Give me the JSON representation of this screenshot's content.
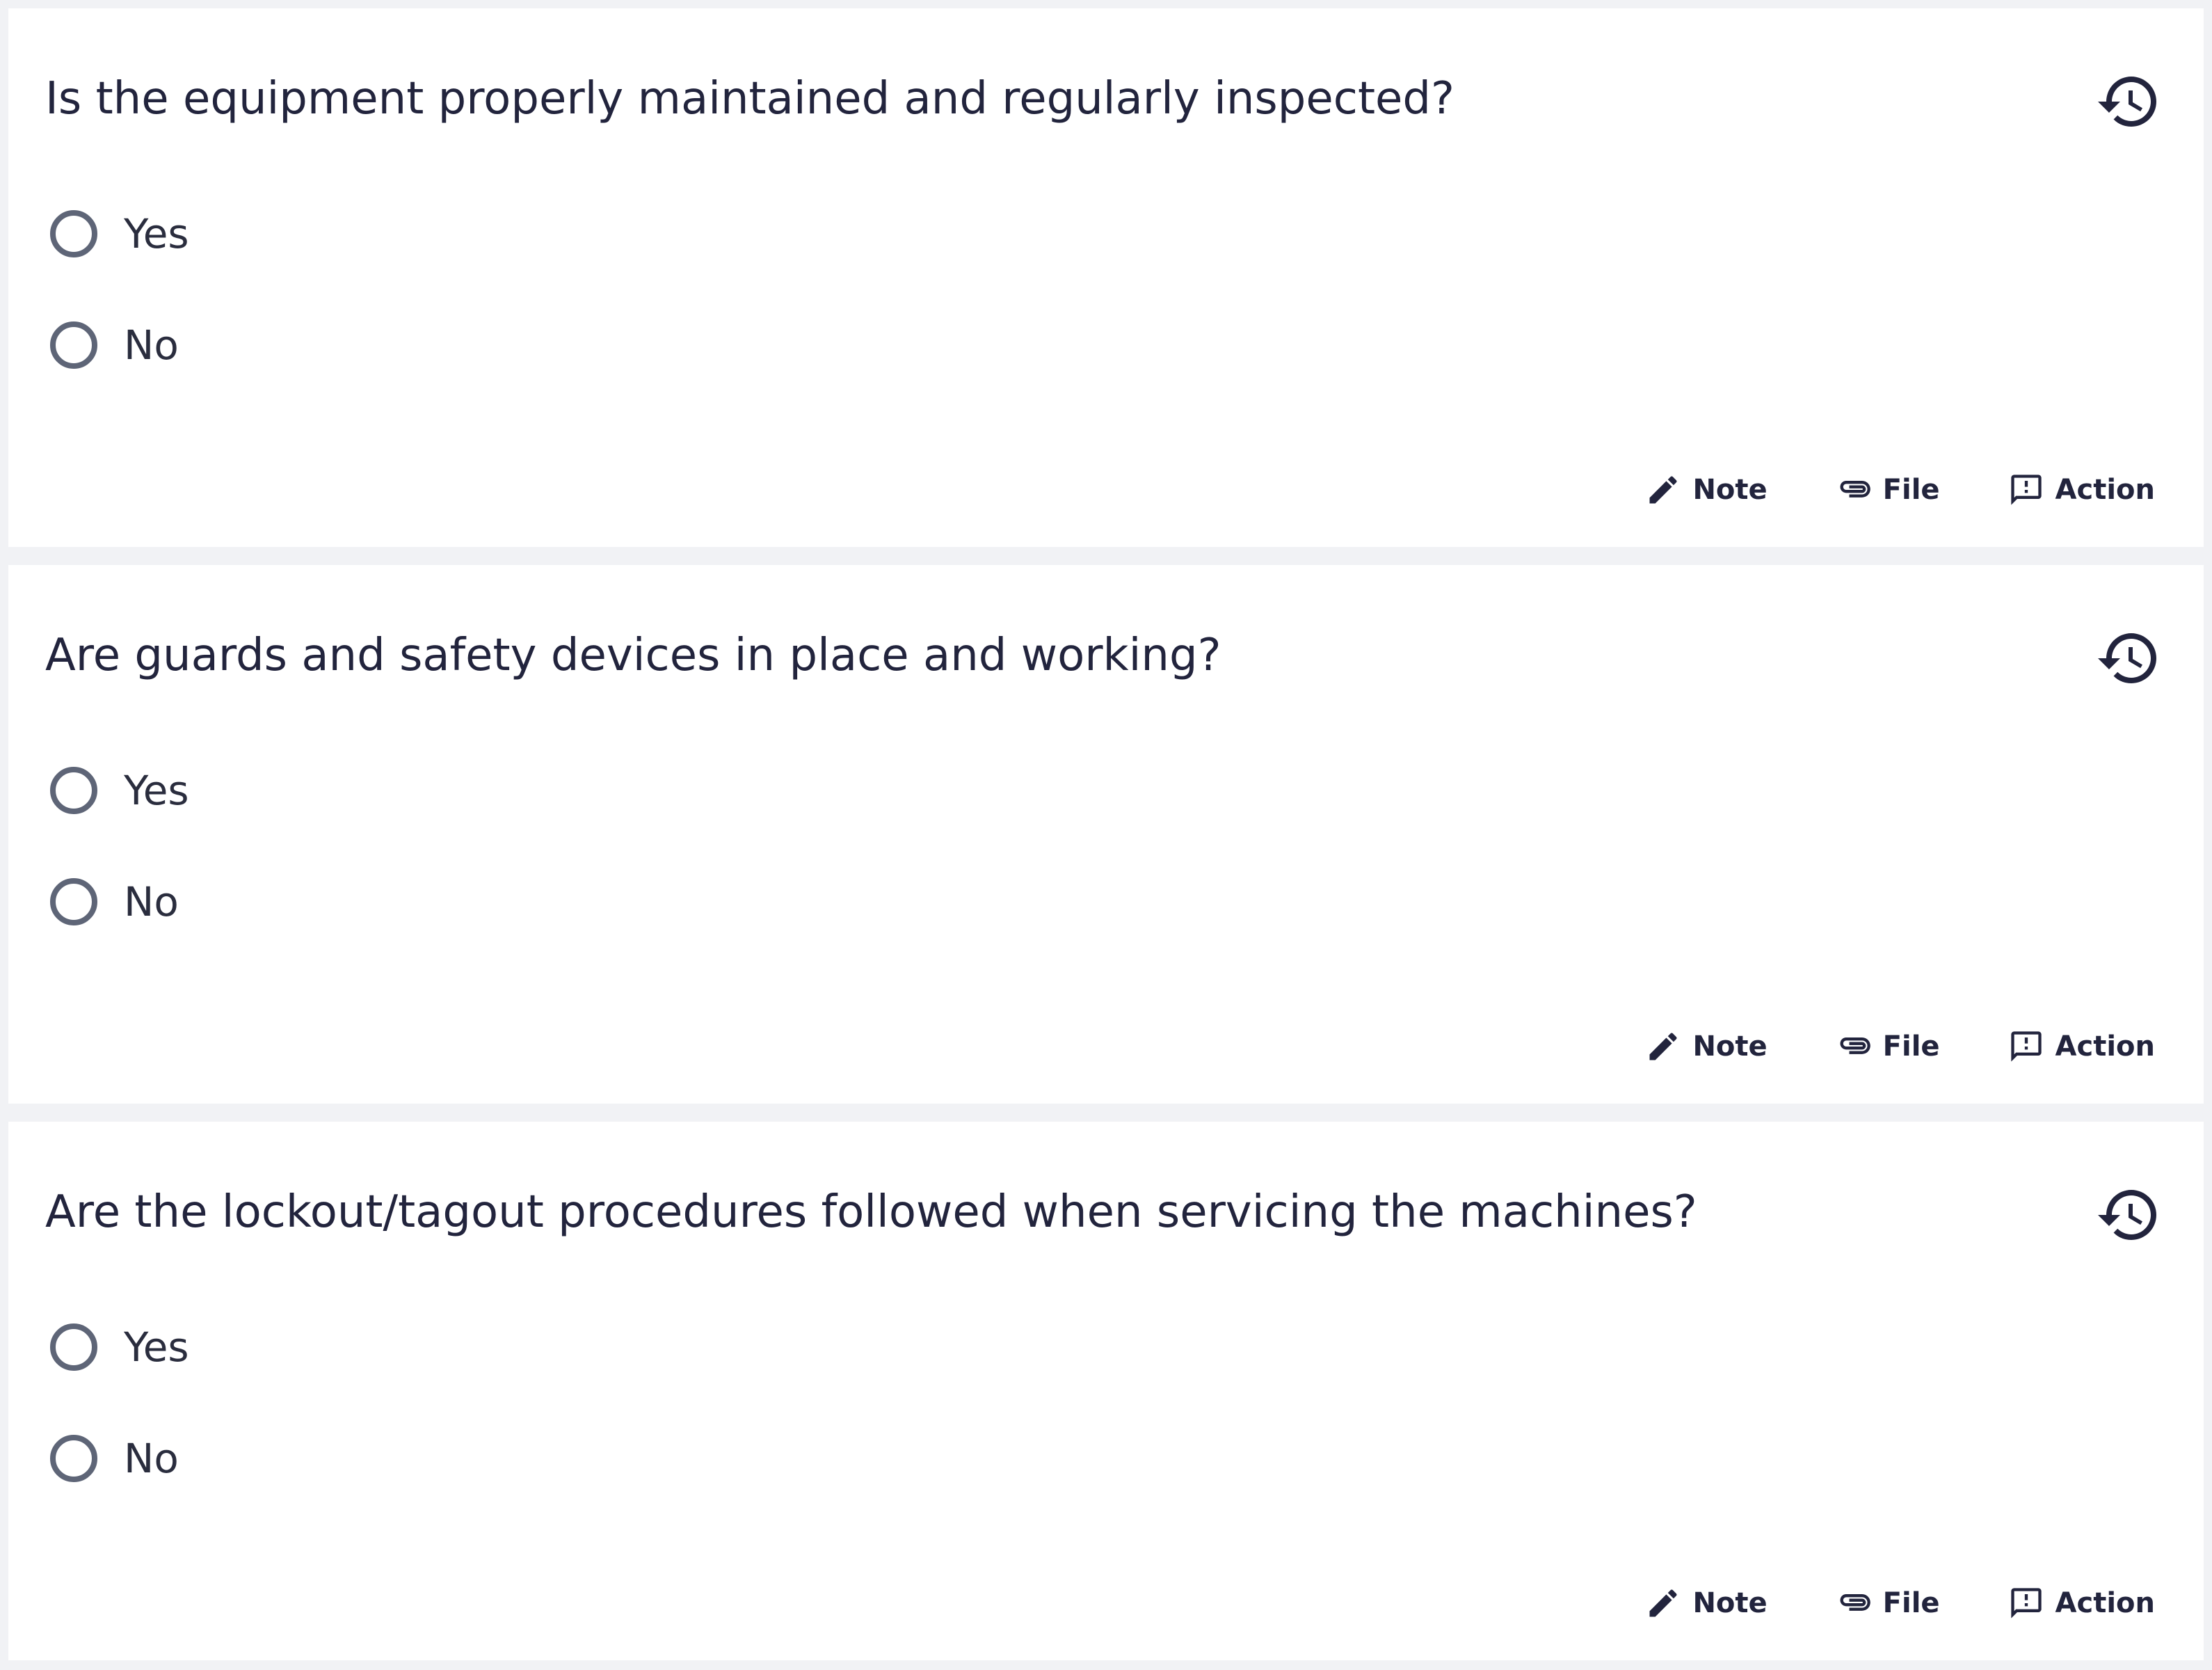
{
  "questions": [
    {
      "text": "Is the equipment properly maintained and regularly inspected?",
      "options": [
        {
          "label": "Yes"
        },
        {
          "label": "No"
        }
      ],
      "actions": {
        "note": "Note",
        "file": "File",
        "action": "Action"
      }
    },
    {
      "text": "Are guards and safety devices in place and working?",
      "options": [
        {
          "label": "Yes"
        },
        {
          "label": "No"
        }
      ],
      "actions": {
        "note": "Note",
        "file": "File",
        "action": "Action"
      }
    },
    {
      "text": "Are the lockout/tagout procedures followed when servicing the machines?",
      "options": [
        {
          "label": "Yes"
        },
        {
          "label": "No"
        }
      ],
      "actions": {
        "note": "Note",
        "file": "File",
        "action": "Action"
      }
    }
  ],
  "icons": {
    "history": "history-icon",
    "note": "pencil-icon",
    "file": "paperclip-icon",
    "action": "report-icon"
  },
  "colors": {
    "page_background": "#f1f2f5",
    "card_background": "#ffffff",
    "text": "#22243d",
    "radio_border": "#5e6577"
  }
}
